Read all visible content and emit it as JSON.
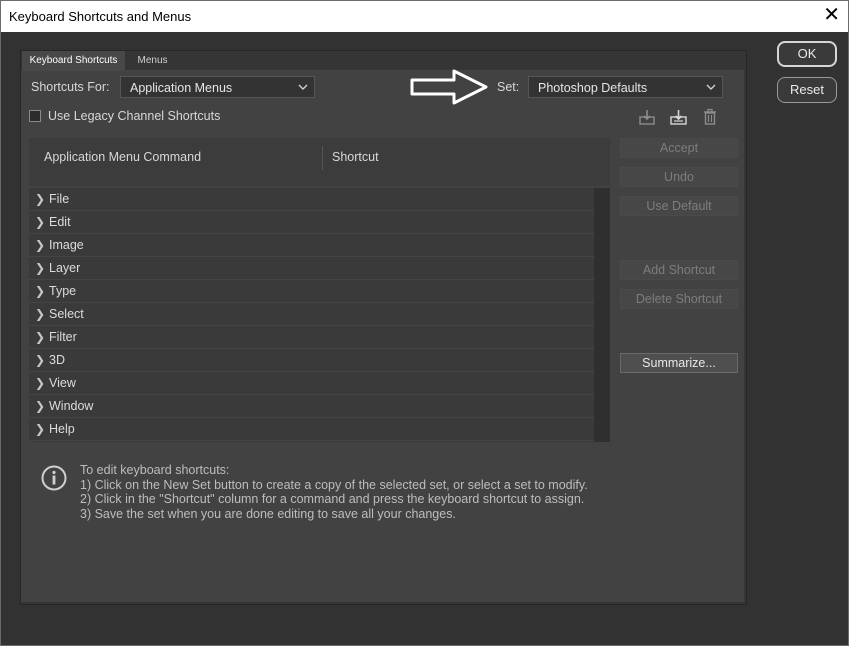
{
  "window": {
    "title": "Keyboard Shortcuts and Menus",
    "close_glyph": "✕"
  },
  "tabs": [
    {
      "label": "Keyboard Shortcuts",
      "active": true
    },
    {
      "label": "Menus",
      "active": false
    }
  ],
  "shortcuts_for": {
    "label": "Shortcuts For:",
    "value": "Application Menus"
  },
  "set": {
    "label": "Set:",
    "value": "Photoshop Defaults"
  },
  "legacy_checkbox": {
    "label": "Use Legacy Channel Shortcuts",
    "checked": false
  },
  "set_icons": [
    "save-set-icon",
    "new-set-icon",
    "delete-set-icon"
  ],
  "table": {
    "columns": [
      "Application Menu Command",
      "Shortcut"
    ],
    "rows": [
      "File",
      "Edit",
      "Image",
      "Layer",
      "Type",
      "Select",
      "Filter",
      "3D",
      "View",
      "Window",
      "Help"
    ]
  },
  "side_buttons": {
    "accept": "Accept",
    "undo": "Undo",
    "use_default": "Use Default",
    "add_shortcut": "Add Shortcut",
    "delete_shortcut": "Delete Shortcut",
    "summarize": "Summarize..."
  },
  "dialog_buttons": {
    "ok": "OK",
    "reset": "Reset"
  },
  "info": {
    "line1": "To edit keyboard shortcuts:",
    "line2": "1) Click on the New Set button to create a copy of the selected set, or select a set to modify.",
    "line3": "2) Click in the \"Shortcut\" column for a command and press the keyboard shortcut to assign.",
    "line4": "3) Save the set when you are done editing to save all your changes."
  },
  "colors": {
    "dialog_bg": "#323232",
    "panel_bg": "#424242",
    "text": "#d8d8d8",
    "disabled_text": "#7d7d7d"
  }
}
